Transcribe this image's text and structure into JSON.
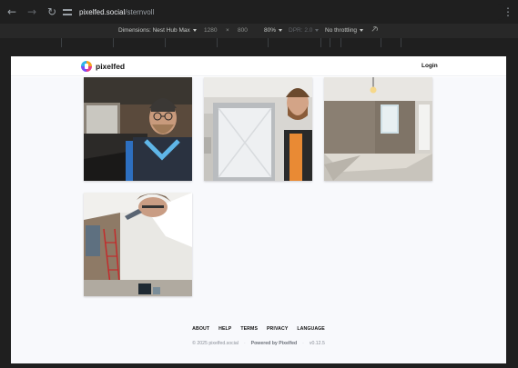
{
  "browser": {
    "url_host": "pixelfed.social",
    "url_path": "/sternvoll"
  },
  "devtools": {
    "dimensions_label": "Dimensions: Nest Hub Max",
    "width": "1280",
    "times": "×",
    "height": "800",
    "zoom": "80%",
    "dpr": "DPR: 2.0",
    "throttling": "No throttling"
  },
  "site": {
    "brand": "pixelfed",
    "login": "Login"
  },
  "photos": [
    {
      "alt": "man with beanie and glasses in blue hoodie"
    },
    {
      "alt": "man at window with plastic sheeting"
    },
    {
      "alt": "empty room with brick wall and ceiling lamp"
    },
    {
      "alt": "upside-down selfie in room under renovation with ladder"
    }
  ],
  "footer": {
    "links": [
      "ABOUT",
      "HELP",
      "TERMS",
      "PRIVACY",
      "LANGUAGE"
    ],
    "copyright": "© 2025 pixelfed.social",
    "sep": "·",
    "powered": "Powered by Pixelfed",
    "version": "v0.12.5"
  },
  "colors": {
    "chrome_bg": "#1f1f1f",
    "devtools_bg": "#282828",
    "page_bg": "#f8f9fc",
    "header_bg": "#ffffff"
  }
}
